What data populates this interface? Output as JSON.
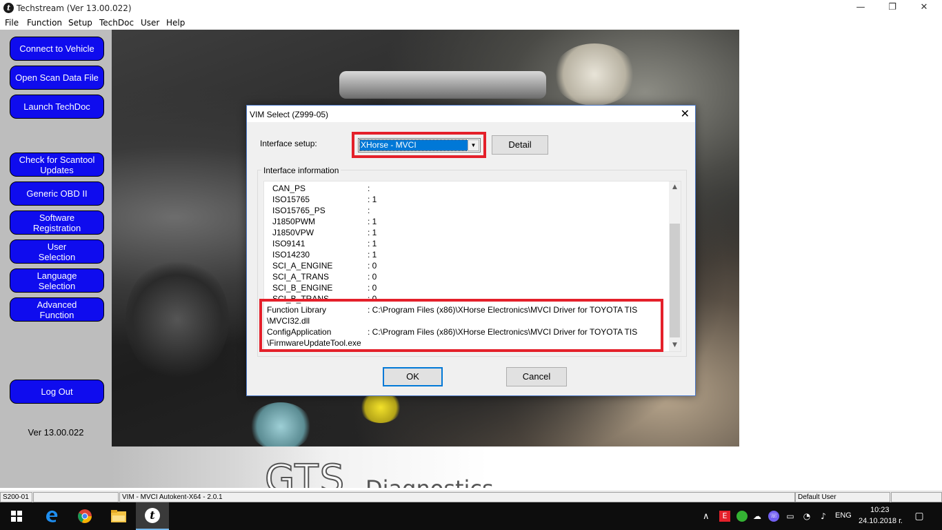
{
  "window": {
    "title": "Techstream (Ver 13.00.022)",
    "icon_glyph": "t",
    "controls": {
      "minimize": "—",
      "maximize": "❐",
      "close": "✕"
    }
  },
  "menu": [
    "File",
    "Function",
    "Setup",
    "TechDoc",
    "User",
    "Help"
  ],
  "sidebar": {
    "buttons": [
      "Connect to Vehicle",
      "Open Scan Data File",
      "Launch TechDoc",
      "Check for Scantool\nUpdates",
      "Generic OBD II",
      "Software\nRegistration",
      "User\nSelection",
      "Language\nSelection",
      "Advanced\nFunction",
      "Log Out"
    ],
    "version": "Ver 13.00.022"
  },
  "branding": {
    "logo": "GTS",
    "sub": "Diagnostics"
  },
  "dialog": {
    "title": "VIM Select (Z999-05)",
    "close_glyph": "✕",
    "interface_label": "Interface setup:",
    "interface_value": "XHorse - MVCI",
    "arrow_glyph": "▼",
    "detail_button": "Detail",
    "group_label": "Interface information",
    "rows": [
      {
        "key": "CAN_PS",
        "value": ":"
      },
      {
        "key": "ISO15765",
        "value": ": 1"
      },
      {
        "key": "ISO15765_PS",
        "value": ":"
      },
      {
        "key": "J1850PWM",
        "value": ": 1"
      },
      {
        "key": "J1850VPW",
        "value": ": 1"
      },
      {
        "key": "ISO9141",
        "value": ": 1"
      },
      {
        "key": "ISO14230",
        "value": ": 1"
      },
      {
        "key": "SCI_A_ENGINE",
        "value": ": 0"
      },
      {
        "key": "SCI_A_TRANS",
        "value": ": 0"
      },
      {
        "key": "SCI_B_ENGINE",
        "value": ": 0"
      },
      {
        "key": "SCI_B_TRANS",
        "value": ": 0"
      }
    ],
    "library_rows": [
      {
        "key": "Function Library",
        "value": ": C:\\Program Files (x86)\\XHorse Electronics\\MVCI Driver for TOYOTA TIS"
      },
      {
        "key": "\\MVCI32.dll",
        "value": ""
      },
      {
        "key": "ConfigApplication",
        "value": ": C:\\Program Files (x86)\\XHorse Electronics\\MVCI Driver for TOYOTA TIS"
      },
      {
        "key": "\\FirmwareUpdateTool.exe",
        "value": ""
      }
    ],
    "scroll_up": "▲",
    "scroll_down": "▼",
    "ok_button": "OK",
    "cancel_button": "Cancel"
  },
  "statusbar": {
    "code": "S200-01",
    "vim": "VIM - MVCI Autokent-X64 - 2.0.1",
    "user": "Default User"
  },
  "taskbar": {
    "language": "ENG",
    "time": "10:23",
    "date": "24.10.2018 г.",
    "chevron_glyph": "∧"
  },
  "colors": {
    "sidebar_button": "#0f0cee",
    "sidebar_bg": "#bdbdbd",
    "highlight_red": "#e4202a",
    "selection_blue": "#0078d7"
  }
}
